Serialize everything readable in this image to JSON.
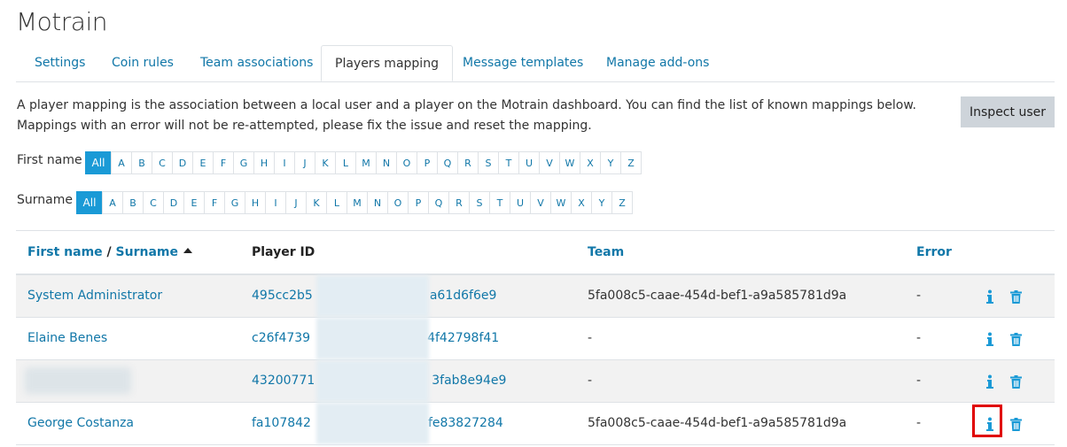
{
  "app": {
    "title": "Motrain"
  },
  "tabs": [
    {
      "label": "Settings"
    },
    {
      "label": "Coin rules"
    },
    {
      "label": "Team associations"
    },
    {
      "label": "Players mapping"
    },
    {
      "label": "Message templates"
    },
    {
      "label": "Manage add-ons"
    }
  ],
  "description": "A player mapping is the association between a local user and a player on the Motrain dashboard. You can find the list of known mappings below. Mappings with an error will not be re-attempted, please fix the issue and reset the mapping.",
  "inspect_button": "Inspect user",
  "firstname_filter": {
    "label": "First name",
    "all": "All",
    "letters": [
      "A",
      "B",
      "C",
      "D",
      "E",
      "F",
      "G",
      "H",
      "I",
      "J",
      "K",
      "L",
      "M",
      "N",
      "O",
      "P",
      "Q",
      "R",
      "S",
      "T",
      "U",
      "V",
      "W",
      "X",
      "Y",
      "Z"
    ]
  },
  "surname_filter": {
    "label": "Surname",
    "all": "All",
    "letters": [
      "A",
      "B",
      "C",
      "D",
      "E",
      "F",
      "G",
      "H",
      "I",
      "J",
      "K",
      "L",
      "M",
      "N",
      "O",
      "P",
      "Q",
      "R",
      "S",
      "T",
      "U",
      "V",
      "W",
      "X",
      "Y",
      "Z"
    ]
  },
  "table": {
    "headers": {
      "first_name": "First name",
      "separator": " / ",
      "surname": "Surname",
      "player_id": "Player ID",
      "team": "Team",
      "error": "Error"
    },
    "rows": [
      {
        "name": "System Administrator",
        "id_start": "495cc2b5",
        "id_end": "a61d6f6e9",
        "team": "5fa008c5-caae-454d-bef1-a9a585781d9a",
        "error": "-"
      },
      {
        "name": "Elaine Benes",
        "id_start": "c26f4739",
        "id_end": "4f42798f41",
        "team": "-",
        "error": "-"
      },
      {
        "name": "",
        "id_start": "43200771",
        "id_end": "3fab8e94e9",
        "team": "-",
        "error": "-"
      },
      {
        "name": "George Costanza",
        "id_start": "fa107842",
        "id_end": "fe83827284",
        "team": "5fa008c5-caae-454d-bef1-a9a585781d9a",
        "error": "-"
      }
    ]
  },
  "icons": {
    "info": "info-icon",
    "delete": "trash-icon"
  },
  "colors": {
    "link": "#1177a8",
    "accent": "#1a9ad6",
    "highlight": "#e00000",
    "button": "#ced4da"
  }
}
